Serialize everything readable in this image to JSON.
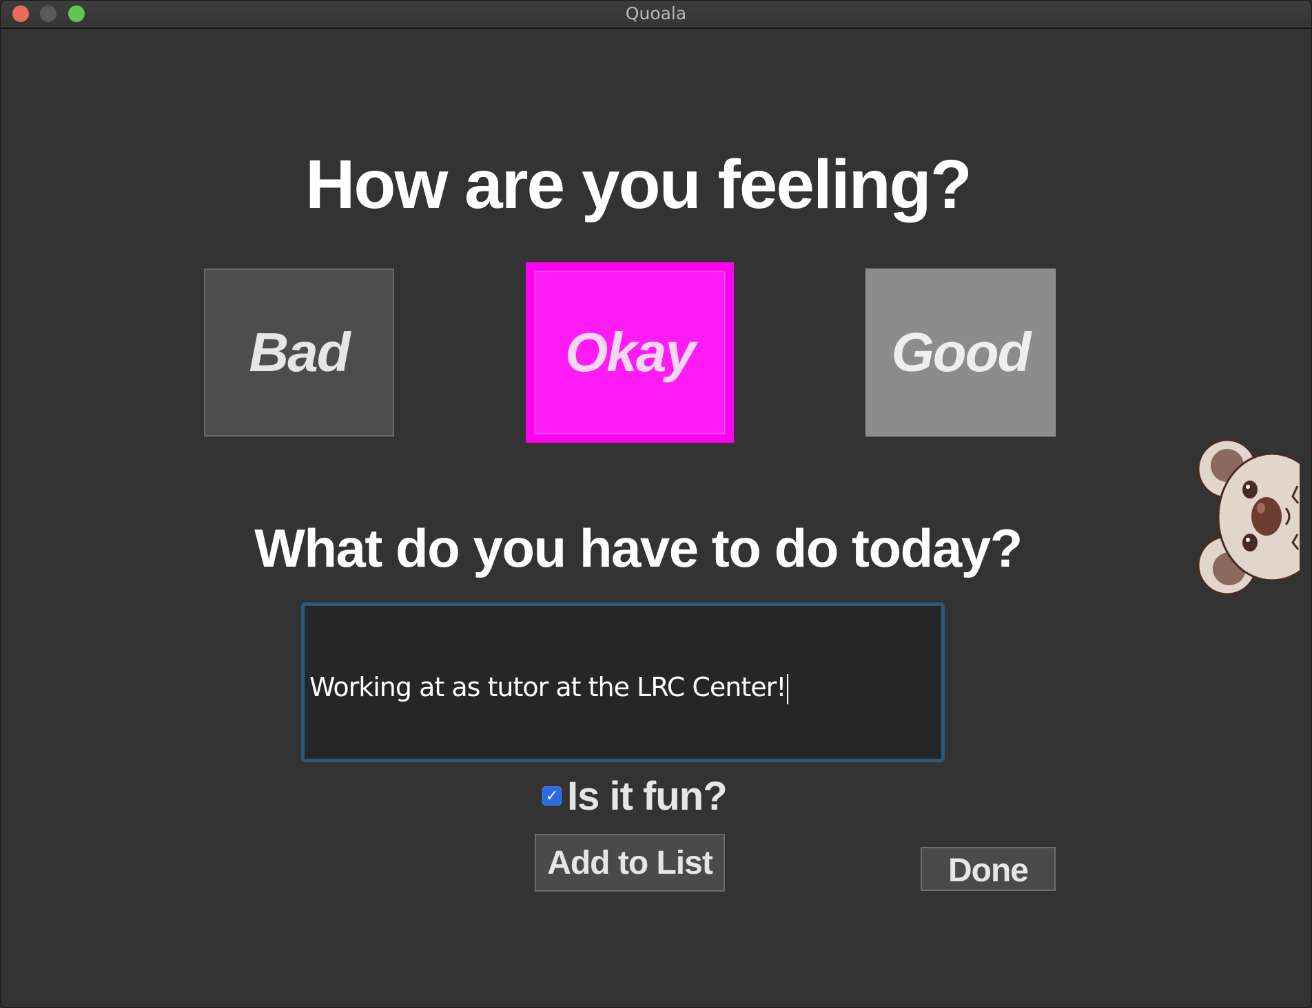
{
  "window": {
    "title": "Quoala"
  },
  "main": {
    "feeling_heading": "How are you feeling?",
    "moods": [
      {
        "label": "Bad",
        "selected": false
      },
      {
        "label": "Okay",
        "selected": true
      },
      {
        "label": "Good",
        "selected": false
      }
    ],
    "todo_heading": "What do you have to do today?",
    "task_input_value": "Working at as tutor at the LRC Center!",
    "fun_checkbox": {
      "label": "Is it fun?",
      "checked": true
    },
    "add_button_label": "Add to List",
    "done_button_label": "Done"
  },
  "colors": {
    "window_bg": "#333333",
    "selected_mood": "#ff1cf4",
    "input_focus_border": "#2d5a7c",
    "checkbox_accent": "#2a6ce6"
  },
  "icons": {
    "mascot": "koala-icon"
  }
}
